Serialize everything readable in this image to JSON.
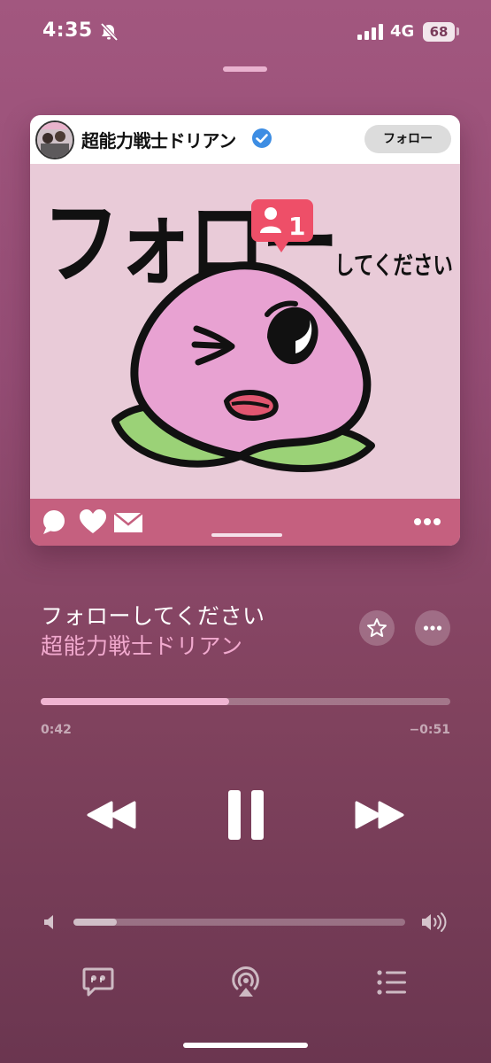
{
  "status_bar": {
    "time": "4:35",
    "network": "4G",
    "battery": "68"
  },
  "artwork": {
    "account_name": "超能力戦士ドリアン",
    "follow_label": "フォロー",
    "title_text": "フォロー",
    "subtitle_text": "してください",
    "notification_count": "1",
    "background_color": "#e9cbd8",
    "footer_color": "#c5607f"
  },
  "track": {
    "title": "フォローしてください",
    "artist": "超能力戦士ドリアン"
  },
  "playback": {
    "elapsed": "0:42",
    "remaining": "−0:51",
    "progress_fraction": 0.46,
    "volume_fraction": 0.13,
    "state": "playing"
  },
  "colors": {
    "accent": "#f1a9ce",
    "progress_fill": "#f0b4d2"
  }
}
